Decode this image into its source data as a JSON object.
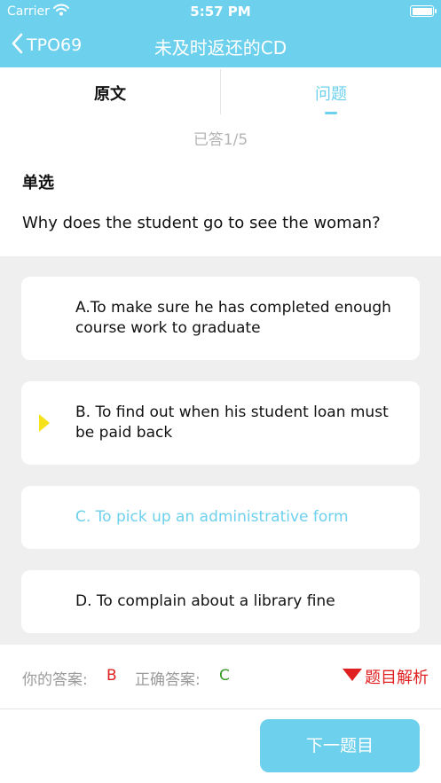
{
  "status_bar": {
    "carrier": "Carrier",
    "time": "5:57 PM"
  },
  "nav": {
    "back_label": "TPO69",
    "title": "未及时返还的CD"
  },
  "tabs": [
    {
      "label": "原文",
      "active": false
    },
    {
      "label": "问题",
      "active": true
    }
  ],
  "progress": "已答1/5",
  "question": {
    "type": "单选",
    "text": "Why does the student go to see the woman?"
  },
  "options": [
    {
      "text": "A.To make sure he has completed enough course work to graduate",
      "selected": false,
      "correct": false
    },
    {
      "text": "B. To find out when his student loan must be paid back",
      "selected": true,
      "correct": false
    },
    {
      "text": "C. To pick up an administrative form",
      "selected": false,
      "correct": true
    },
    {
      "text": "D. To complain about a library fine",
      "selected": false,
      "correct": false
    }
  ],
  "answer_row": {
    "your_answer_label": "你的答案:",
    "your_answer": "B",
    "correct_answer_label": "正确答案:",
    "correct_answer": "C",
    "analysis_label": "题目解析"
  },
  "next_button": "下一题目",
  "colors": {
    "accent": "#6dd0ec",
    "wrong": "#e02020",
    "correct_answer": "#3a9a2a",
    "selected_marker": "#f5e21b"
  },
  "icons": {
    "back": "chevron-left-icon",
    "wifi": "wifi-icon",
    "battery": "battery-icon",
    "marker": "triangle-right-icon",
    "analysis": "triangle-down-icon"
  }
}
